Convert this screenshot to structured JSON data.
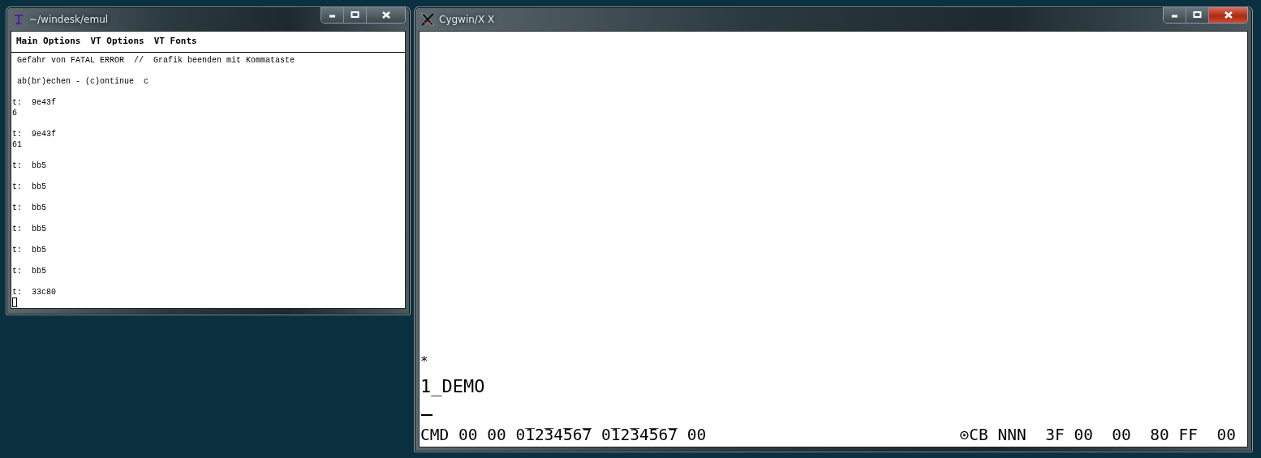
{
  "windows": [
    {
      "title": "~/windesk/emul",
      "menu": [
        {
          "label": "Main Options"
        },
        {
          "label": "VT Options"
        },
        {
          "label": "VT Fonts"
        }
      ],
      "terminal": [
        [
          " Gefahr von FATAL ERROR  //  Grafik beenden mit Kommataste"
        ],
        [
          " ab(br)echen - (c)ontinue  c"
        ],
        [
          "t:  9e43f",
          "6"
        ],
        [
          "t:  9e43f",
          "61"
        ],
        [
          "t:  bb5"
        ],
        [
          "t:  bb5"
        ],
        [
          "t:  bb5"
        ],
        [
          "t:  bb5"
        ],
        [
          "t:  bb5"
        ],
        [
          "t:  bb5"
        ],
        [
          "t:  33c80"
        ]
      ],
      "close_hot": false
    },
    {
      "title": "Cygwin/X X",
      "lines": [
        "*",
        "1_DEMO"
      ],
      "status": [
        "CMD 00 00 0̅12̅34̅56̅7 0̅12̅34̅56̅7 00",
        "⊙CB NNN  3F 00  00  80 FF  00"
      ],
      "close_hot": true
    }
  ]
}
